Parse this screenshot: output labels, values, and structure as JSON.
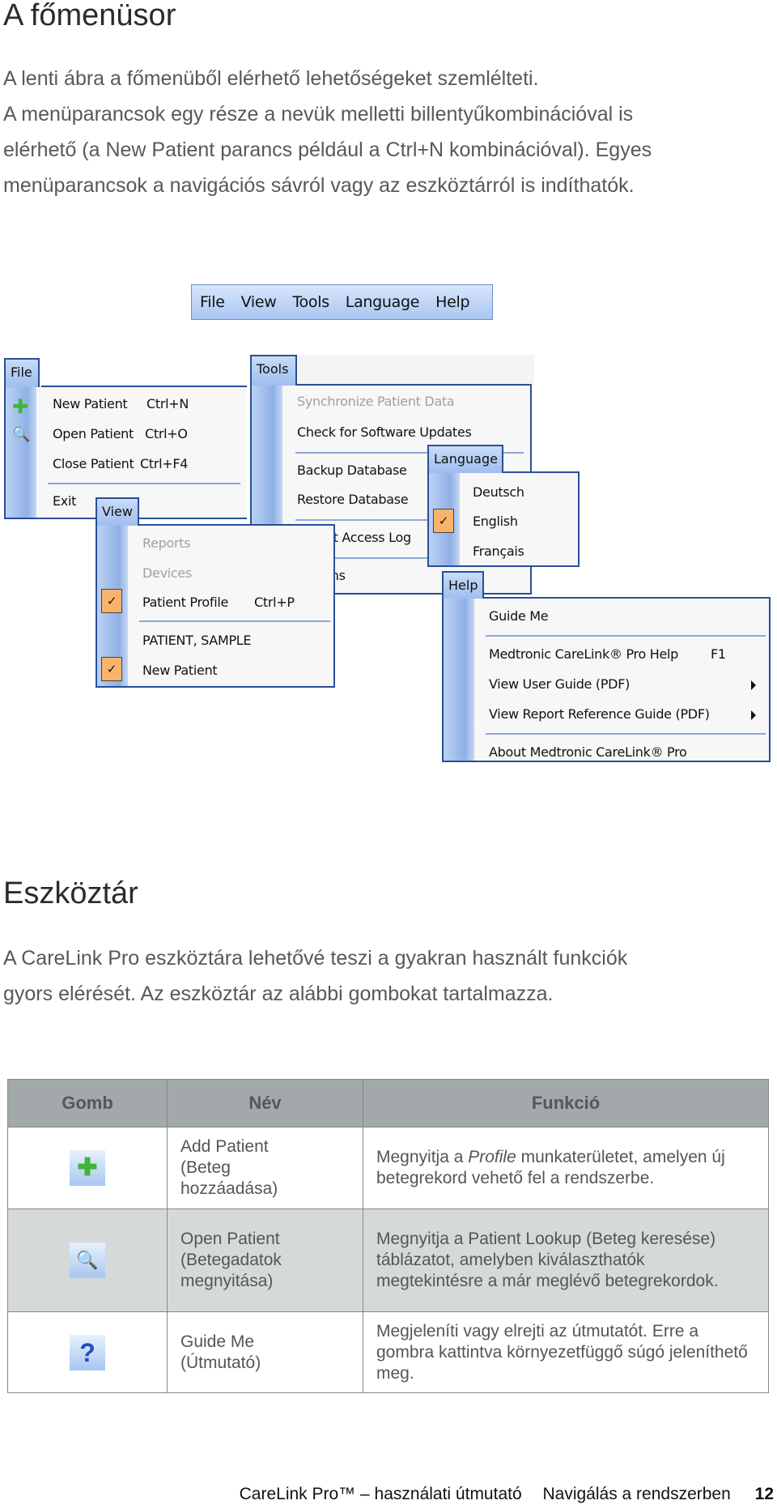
{
  "section1": {
    "title": "A főmenüsor",
    "paragraph": [
      "A lenti ábra a főmenüből elérhető lehetőségeket szemlélteti.",
      "A menüparancsok egy része a nevük melletti billentyűkombinációval is",
      "elérhető (a New Patient parancs például a Ctrl+N kombinációval). Egyes",
      "menüparancsok a navigációs sávról vagy az eszköztárról is indíthatók."
    ]
  },
  "menubar": [
    "File",
    "View",
    "Tools",
    "Language",
    "Help"
  ],
  "file_menu": {
    "tab": "File",
    "items": [
      {
        "label": "New Patient",
        "shortcut": "Ctrl+N",
        "icon": "add-green-plus-icon"
      },
      {
        "label": "Open Patient",
        "shortcut": "Ctrl+O",
        "icon": "magnifier-icon"
      },
      {
        "label": "Close Patient",
        "shortcut": "Ctrl+F4"
      },
      {
        "label": "Exit"
      }
    ]
  },
  "tools_menu": {
    "tab": "Tools",
    "items": [
      {
        "label": "Synchronize Patient Data",
        "disabled": true
      },
      {
        "label": "Check for Software Updates"
      },
      {
        "label": "Backup Database"
      },
      {
        "label": "Restore Database"
      },
      {
        "label": "Export Access Log"
      },
      {
        "label": "Options"
      }
    ]
  },
  "view_menu": {
    "tab": "View",
    "items": [
      {
        "label": "Reports",
        "disabled": true
      },
      {
        "label": "Devices",
        "disabled": true
      },
      {
        "label": "Patient Profile",
        "shortcut": "Ctrl+P",
        "checked": true
      },
      {
        "label": "PATIENT, SAMPLE"
      },
      {
        "label": "New Patient",
        "checked": true
      }
    ]
  },
  "language_menu": {
    "tab": "Language",
    "items": [
      {
        "label": "Deutsch"
      },
      {
        "label": "English",
        "checked": true
      },
      {
        "label": "Français"
      }
    ]
  },
  "help_menu": {
    "tab": "Help",
    "items": [
      {
        "label": "Guide Me"
      },
      {
        "label": "Medtronic CareLink® Pro Help",
        "shortcut": "F1"
      },
      {
        "label": "View User Guide (PDF)",
        "submenu": true
      },
      {
        "label": "View Report Reference Guide (PDF)",
        "submenu": true
      },
      {
        "label": "About Medtronic CareLink® Pro"
      }
    ]
  },
  "check_mark": "✓",
  "section2": {
    "title": "Eszköztár",
    "paragraph": [
      "A CareLink Pro eszköztára lehetővé teszi a gyakran használt funkciók",
      "gyors elérését. Az eszköztár az alábbi gombokat tartalmazza."
    ]
  },
  "table": {
    "headers": [
      "Gomb",
      "Név",
      "Funkció"
    ],
    "rows": [
      {
        "icon": "add-patient-icon",
        "glyph": "✚",
        "name": [
          "Add Patient",
          "(Beteg",
          "hozzáadása)"
        ],
        "func_pre": "Megnyitja a ",
        "func_em": "Profile",
        "func_post": " munkaterületet, amelyen új betegrekord vehető fel a rendszerbe."
      },
      {
        "icon": "open-patient-icon",
        "glyph": "🔍",
        "name": [
          "Open Patient",
          "(Betegadatok",
          "megnyitása)"
        ],
        "func_pre": "Megnyitja a Patient Lookup (Beteg keresése) táblázatot, amelyben kiválaszthatók megtekintésre a már meglévő betegrekordok.",
        "func_em": "",
        "func_post": ""
      },
      {
        "icon": "guide-me-icon",
        "glyph": "?",
        "name": [
          "Guide Me",
          "(Útmutató)"
        ],
        "func_pre": "Megjeleníti vagy elrejti az útmutatót. Erre a gombra kattintva környezetfüggő súgó jeleníthető meg.",
        "func_em": "",
        "func_post": ""
      }
    ]
  },
  "footer": {
    "doc": "CareLink Pro™ – használati útmutató",
    "section": "Navigálás a rendszerben",
    "page": "12"
  }
}
